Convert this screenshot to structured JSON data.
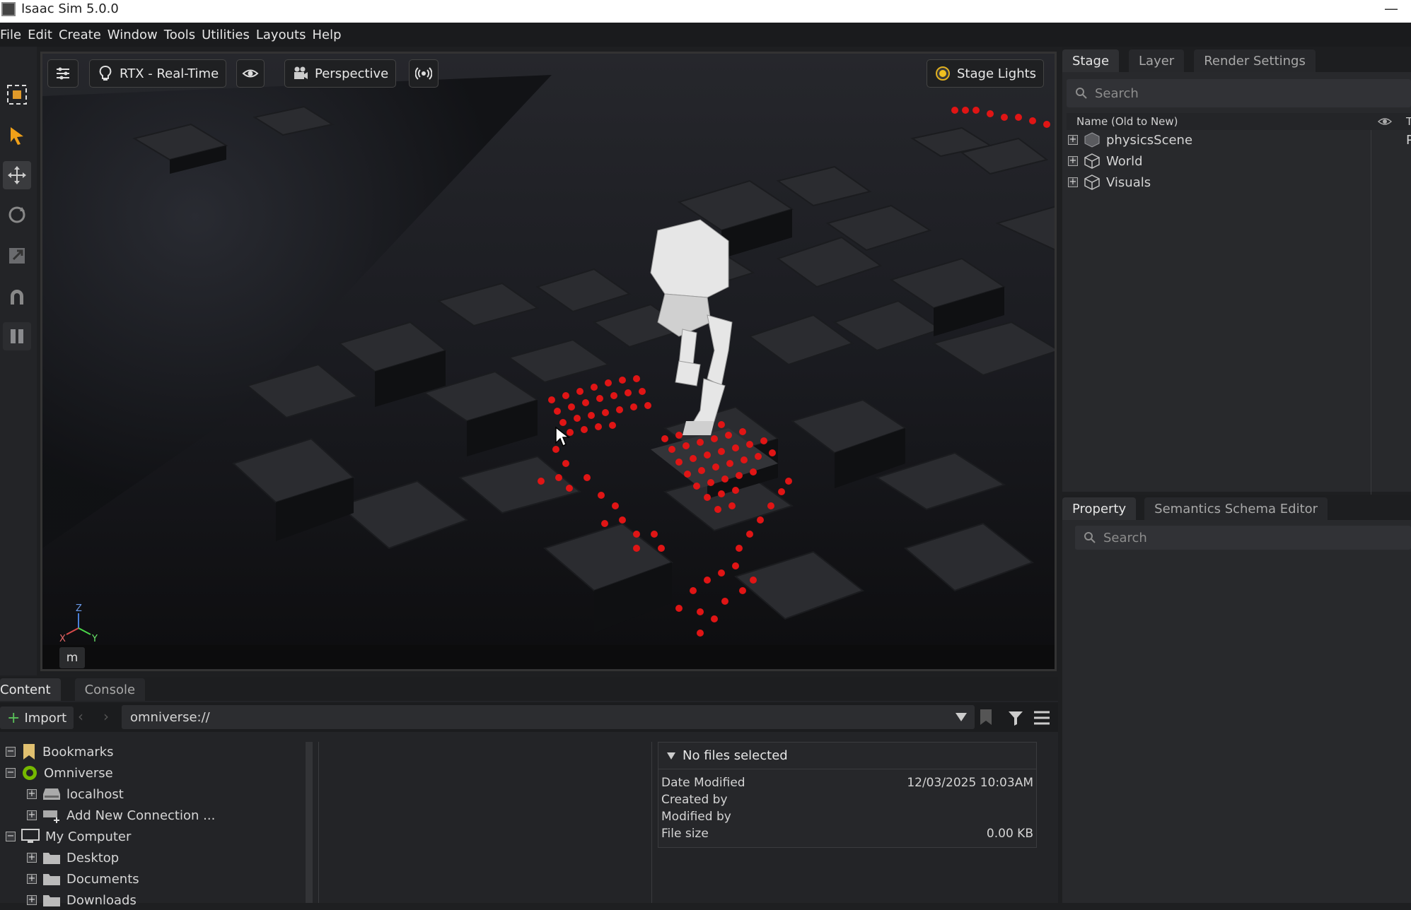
{
  "window": {
    "title": "Isaac Sim 5.0.0",
    "minimize_glyph": "—"
  },
  "menu": [
    "File",
    "Edit",
    "Create",
    "Window",
    "Tools",
    "Utilities",
    "Layouts",
    "Help"
  ],
  "viewport": {
    "render_mode": "RTX - Real-Time",
    "camera": "Perspective",
    "lights": "Stage Lights",
    "axis_labels": {
      "z": "Z",
      "x": "X",
      "y": "Y"
    },
    "unit_badge": "m"
  },
  "stage": {
    "tabs": [
      "Stage",
      "Layer",
      "Render Settings"
    ],
    "search_placeholder": "Search",
    "column_header": "Name (Old to New)",
    "column_header_right": "T",
    "items": [
      {
        "name": "physicsScene",
        "right": "P"
      },
      {
        "name": "World",
        "right": ""
      },
      {
        "name": "Visuals",
        "right": ""
      }
    ]
  },
  "property": {
    "tabs": [
      "Property",
      "Semantics Schema Editor"
    ],
    "search_placeholder": "Search"
  },
  "content": {
    "tabs": [
      "Content",
      "Console"
    ],
    "import_label": "Import",
    "path": "omniverse://",
    "tree": [
      {
        "label": "Bookmarks",
        "level": 0,
        "toggle": "−",
        "icon": "bookmark-icon"
      },
      {
        "label": "Omniverse",
        "level": 0,
        "toggle": "−",
        "icon": "omniverse-icon"
      },
      {
        "label": "localhost",
        "level": 1,
        "toggle": "+",
        "icon": "server-icon"
      },
      {
        "label": "Add New Connection ...",
        "level": 1,
        "toggle": "+",
        "icon": "add-server-icon"
      },
      {
        "label": "My Computer",
        "level": 0,
        "toggle": "−",
        "icon": "computer-icon"
      },
      {
        "label": "Desktop",
        "level": 1,
        "toggle": "+",
        "icon": "folder-icon"
      },
      {
        "label": "Documents",
        "level": 1,
        "toggle": "+",
        "icon": "folder-icon"
      },
      {
        "label": "Downloads",
        "level": 1,
        "toggle": "+",
        "icon": "folder-icon"
      }
    ],
    "details": {
      "header": "No files selected",
      "rows": [
        {
          "label": "Date Modified",
          "value": "12/03/2025 10:03AM"
        },
        {
          "label": "Created by",
          "value": ""
        },
        {
          "label": "Modified by",
          "value": ""
        },
        {
          "label": "File size",
          "value": "0.00 KB"
        }
      ]
    }
  },
  "colors": {
    "accent": "#f0a018",
    "active_tab": "#2f3033",
    "marker_red": "#e01515"
  }
}
